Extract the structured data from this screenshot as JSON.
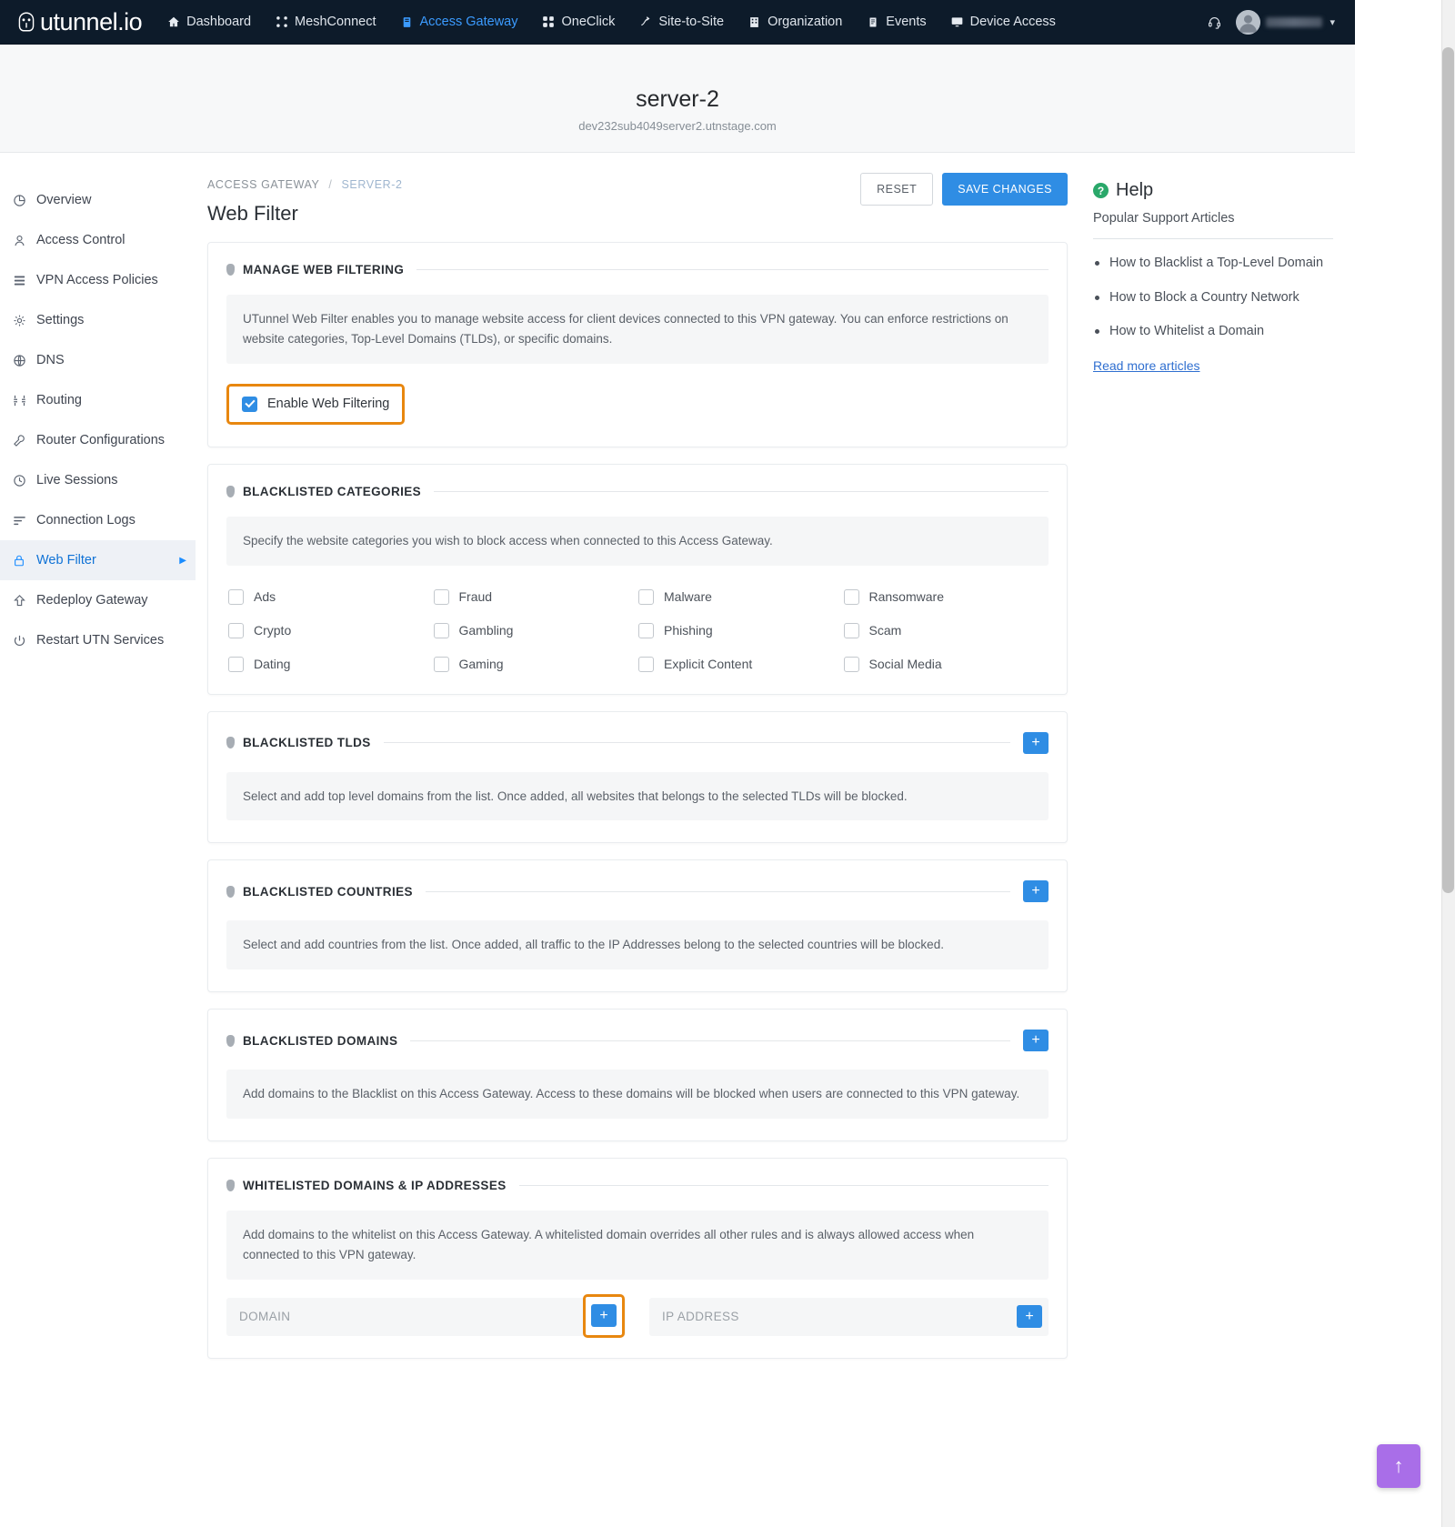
{
  "navbar": {
    "brand": "utunnel.io",
    "items": [
      {
        "label": "Dashboard",
        "icon": "home-icon",
        "active": false
      },
      {
        "label": "MeshConnect",
        "icon": "mesh-icon",
        "active": false
      },
      {
        "label": "Access Gateway",
        "icon": "gateway-icon",
        "active": true
      },
      {
        "label": "OneClick",
        "icon": "oneclick-icon",
        "active": false
      },
      {
        "label": "Site-to-Site",
        "icon": "site-to-site-icon",
        "active": false
      },
      {
        "label": "Organization",
        "icon": "organization-icon",
        "active": false
      },
      {
        "label": "Events",
        "icon": "events-icon",
        "active": false
      },
      {
        "label": "Device Access",
        "icon": "device-access-icon",
        "active": false
      }
    ],
    "support_icon": "headset-icon",
    "avatar_icon": "avatar",
    "caret": "▾"
  },
  "page_header": {
    "title": "server-2",
    "subtitle": "dev232sub4049server2.utnstage.com"
  },
  "sidebar": {
    "items": [
      {
        "label": "Overview",
        "icon": "pie-chart-icon",
        "active": false
      },
      {
        "label": "Access Control",
        "icon": "user-icon",
        "active": false
      },
      {
        "label": "VPN Access Policies",
        "icon": "list-icon",
        "active": false
      },
      {
        "label": "Settings",
        "icon": "gear-icon",
        "active": false
      },
      {
        "label": "DNS",
        "icon": "globe-icon",
        "active": false
      },
      {
        "label": "Routing",
        "icon": "routing-icon",
        "active": false
      },
      {
        "label": "Router Configurations",
        "icon": "wrench-icon",
        "active": false
      },
      {
        "label": "Live Sessions",
        "icon": "clock-icon",
        "active": false
      },
      {
        "label": "Connection Logs",
        "icon": "logs-icon",
        "active": false
      },
      {
        "label": "Web Filter",
        "icon": "lock-icon",
        "active": true
      },
      {
        "label": "Redeploy Gateway",
        "icon": "deploy-icon",
        "active": false
      },
      {
        "label": "Restart UTN Services",
        "icon": "restart-icon",
        "active": false
      }
    ],
    "active_arrow": "▶"
  },
  "breadcrumb": {
    "root": "ACCESS GATEWAY",
    "separator": "/",
    "current": "SERVER-2"
  },
  "main": {
    "title": "Web Filter",
    "reset_label": "RESET",
    "save_label": "SAVE CHANGES",
    "sections": {
      "manage": {
        "title": "MANAGE WEB FILTERING",
        "description": "UTunnel Web Filter enables you to manage website access for client devices connected to this VPN gateway. You can enforce restrictions on website categories, Top-Level Domains (TLDs), or specific domains.",
        "enable_label": "Enable Web Filtering",
        "enable_checked": true
      },
      "categories": {
        "title": "BLACKLISTED CATEGORIES",
        "description": "Specify the website categories you wish to block access when connected to this Access Gateway.",
        "items": [
          {
            "label": "Ads",
            "checked": false
          },
          {
            "label": "Fraud",
            "checked": false
          },
          {
            "label": "Malware",
            "checked": false
          },
          {
            "label": "Ransomware",
            "checked": false
          },
          {
            "label": "Crypto",
            "checked": false
          },
          {
            "label": "Gambling",
            "checked": false
          },
          {
            "label": "Phishing",
            "checked": false
          },
          {
            "label": "Scam",
            "checked": false
          },
          {
            "label": "Dating",
            "checked": false
          },
          {
            "label": "Gaming",
            "checked": false
          },
          {
            "label": "Explicit Content",
            "checked": false
          },
          {
            "label": "Social Media",
            "checked": false
          }
        ]
      },
      "tlds": {
        "title": "BLACKLISTED TLDS",
        "description": "Select and add top level domains from the list. Once added, all websites that belongs to the selected TLDs will be blocked.",
        "add_label": "+"
      },
      "countries": {
        "title": "BLACKLISTED COUNTRIES",
        "description": "Select and add countries from the list. Once added, all traffic to the IP Addresses belong to the selected countries will be blocked.",
        "add_label": "+"
      },
      "domains": {
        "title": "BLACKLISTED DOMAINS",
        "description": "Add domains to the Blacklist on this Access Gateway. Access to these domains will be blocked when users are connected to this VPN gateway.",
        "add_label": "+"
      },
      "whitelist": {
        "title": "WHITELISTED DOMAINS & IP ADDRESSES",
        "description": "Add domains to the whitelist on this Access Gateway. A whitelisted domain overrides all other rules and is always allowed access when connected to this VPN gateway.",
        "domain_placeholder": "DOMAIN",
        "domain_value": "",
        "domain_add_label": "+",
        "ip_placeholder": "IP ADDRESS",
        "ip_value": "",
        "ip_add_label": "+"
      }
    }
  },
  "help": {
    "title": "Help",
    "badge": "?",
    "subtitle": "Popular Support Articles",
    "articles": [
      "How to Blacklist a Top-Level Domain",
      "How to Block a Country Network",
      "How to Whitelist a Domain"
    ],
    "read_more": "Read more articles"
  },
  "scroll_top_button": {
    "icon": "arrow-up-icon",
    "label": "↑"
  },
  "colors": {
    "navbar_bg": "#0d1b2a",
    "accent_blue": "#2f8de4",
    "active_nav": "#3b9bff",
    "highlight_orange": "#e8870f",
    "help_green": "#2aa86a",
    "fab_purple": "#a96ee8"
  }
}
